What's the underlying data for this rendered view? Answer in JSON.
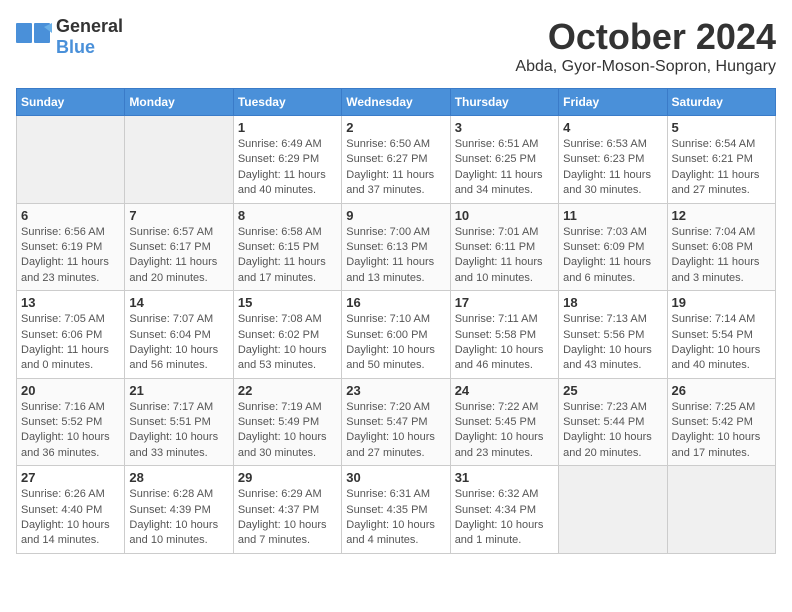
{
  "header": {
    "logo_general": "General",
    "logo_blue": "Blue",
    "title": "October 2024",
    "subtitle": "Abda, Gyor-Moson-Sopron, Hungary"
  },
  "days_of_week": [
    "Sunday",
    "Monday",
    "Tuesday",
    "Wednesday",
    "Thursday",
    "Friday",
    "Saturday"
  ],
  "weeks": [
    [
      {
        "day": "",
        "info": ""
      },
      {
        "day": "",
        "info": ""
      },
      {
        "day": "1",
        "info": "Sunrise: 6:49 AM\nSunset: 6:29 PM\nDaylight: 11 hours and 40 minutes."
      },
      {
        "day": "2",
        "info": "Sunrise: 6:50 AM\nSunset: 6:27 PM\nDaylight: 11 hours and 37 minutes."
      },
      {
        "day": "3",
        "info": "Sunrise: 6:51 AM\nSunset: 6:25 PM\nDaylight: 11 hours and 34 minutes."
      },
      {
        "day": "4",
        "info": "Sunrise: 6:53 AM\nSunset: 6:23 PM\nDaylight: 11 hours and 30 minutes."
      },
      {
        "day": "5",
        "info": "Sunrise: 6:54 AM\nSunset: 6:21 PM\nDaylight: 11 hours and 27 minutes."
      }
    ],
    [
      {
        "day": "6",
        "info": "Sunrise: 6:56 AM\nSunset: 6:19 PM\nDaylight: 11 hours and 23 minutes."
      },
      {
        "day": "7",
        "info": "Sunrise: 6:57 AM\nSunset: 6:17 PM\nDaylight: 11 hours and 20 minutes."
      },
      {
        "day": "8",
        "info": "Sunrise: 6:58 AM\nSunset: 6:15 PM\nDaylight: 11 hours and 17 minutes."
      },
      {
        "day": "9",
        "info": "Sunrise: 7:00 AM\nSunset: 6:13 PM\nDaylight: 11 hours and 13 minutes."
      },
      {
        "day": "10",
        "info": "Sunrise: 7:01 AM\nSunset: 6:11 PM\nDaylight: 11 hours and 10 minutes."
      },
      {
        "day": "11",
        "info": "Sunrise: 7:03 AM\nSunset: 6:09 PM\nDaylight: 11 hours and 6 minutes."
      },
      {
        "day": "12",
        "info": "Sunrise: 7:04 AM\nSunset: 6:08 PM\nDaylight: 11 hours and 3 minutes."
      }
    ],
    [
      {
        "day": "13",
        "info": "Sunrise: 7:05 AM\nSunset: 6:06 PM\nDaylight: 11 hours and 0 minutes."
      },
      {
        "day": "14",
        "info": "Sunrise: 7:07 AM\nSunset: 6:04 PM\nDaylight: 10 hours and 56 minutes."
      },
      {
        "day": "15",
        "info": "Sunrise: 7:08 AM\nSunset: 6:02 PM\nDaylight: 10 hours and 53 minutes."
      },
      {
        "day": "16",
        "info": "Sunrise: 7:10 AM\nSunset: 6:00 PM\nDaylight: 10 hours and 50 minutes."
      },
      {
        "day": "17",
        "info": "Sunrise: 7:11 AM\nSunset: 5:58 PM\nDaylight: 10 hours and 46 minutes."
      },
      {
        "day": "18",
        "info": "Sunrise: 7:13 AM\nSunset: 5:56 PM\nDaylight: 10 hours and 43 minutes."
      },
      {
        "day": "19",
        "info": "Sunrise: 7:14 AM\nSunset: 5:54 PM\nDaylight: 10 hours and 40 minutes."
      }
    ],
    [
      {
        "day": "20",
        "info": "Sunrise: 7:16 AM\nSunset: 5:52 PM\nDaylight: 10 hours and 36 minutes."
      },
      {
        "day": "21",
        "info": "Sunrise: 7:17 AM\nSunset: 5:51 PM\nDaylight: 10 hours and 33 minutes."
      },
      {
        "day": "22",
        "info": "Sunrise: 7:19 AM\nSunset: 5:49 PM\nDaylight: 10 hours and 30 minutes."
      },
      {
        "day": "23",
        "info": "Sunrise: 7:20 AM\nSunset: 5:47 PM\nDaylight: 10 hours and 27 minutes."
      },
      {
        "day": "24",
        "info": "Sunrise: 7:22 AM\nSunset: 5:45 PM\nDaylight: 10 hours and 23 minutes."
      },
      {
        "day": "25",
        "info": "Sunrise: 7:23 AM\nSunset: 5:44 PM\nDaylight: 10 hours and 20 minutes."
      },
      {
        "day": "26",
        "info": "Sunrise: 7:25 AM\nSunset: 5:42 PM\nDaylight: 10 hours and 17 minutes."
      }
    ],
    [
      {
        "day": "27",
        "info": "Sunrise: 6:26 AM\nSunset: 4:40 PM\nDaylight: 10 hours and 14 minutes."
      },
      {
        "day": "28",
        "info": "Sunrise: 6:28 AM\nSunset: 4:39 PM\nDaylight: 10 hours and 10 minutes."
      },
      {
        "day": "29",
        "info": "Sunrise: 6:29 AM\nSunset: 4:37 PM\nDaylight: 10 hours and 7 minutes."
      },
      {
        "day": "30",
        "info": "Sunrise: 6:31 AM\nSunset: 4:35 PM\nDaylight: 10 hours and 4 minutes."
      },
      {
        "day": "31",
        "info": "Sunrise: 6:32 AM\nSunset: 4:34 PM\nDaylight: 10 hours and 1 minute."
      },
      {
        "day": "",
        "info": ""
      },
      {
        "day": "",
        "info": ""
      }
    ]
  ]
}
